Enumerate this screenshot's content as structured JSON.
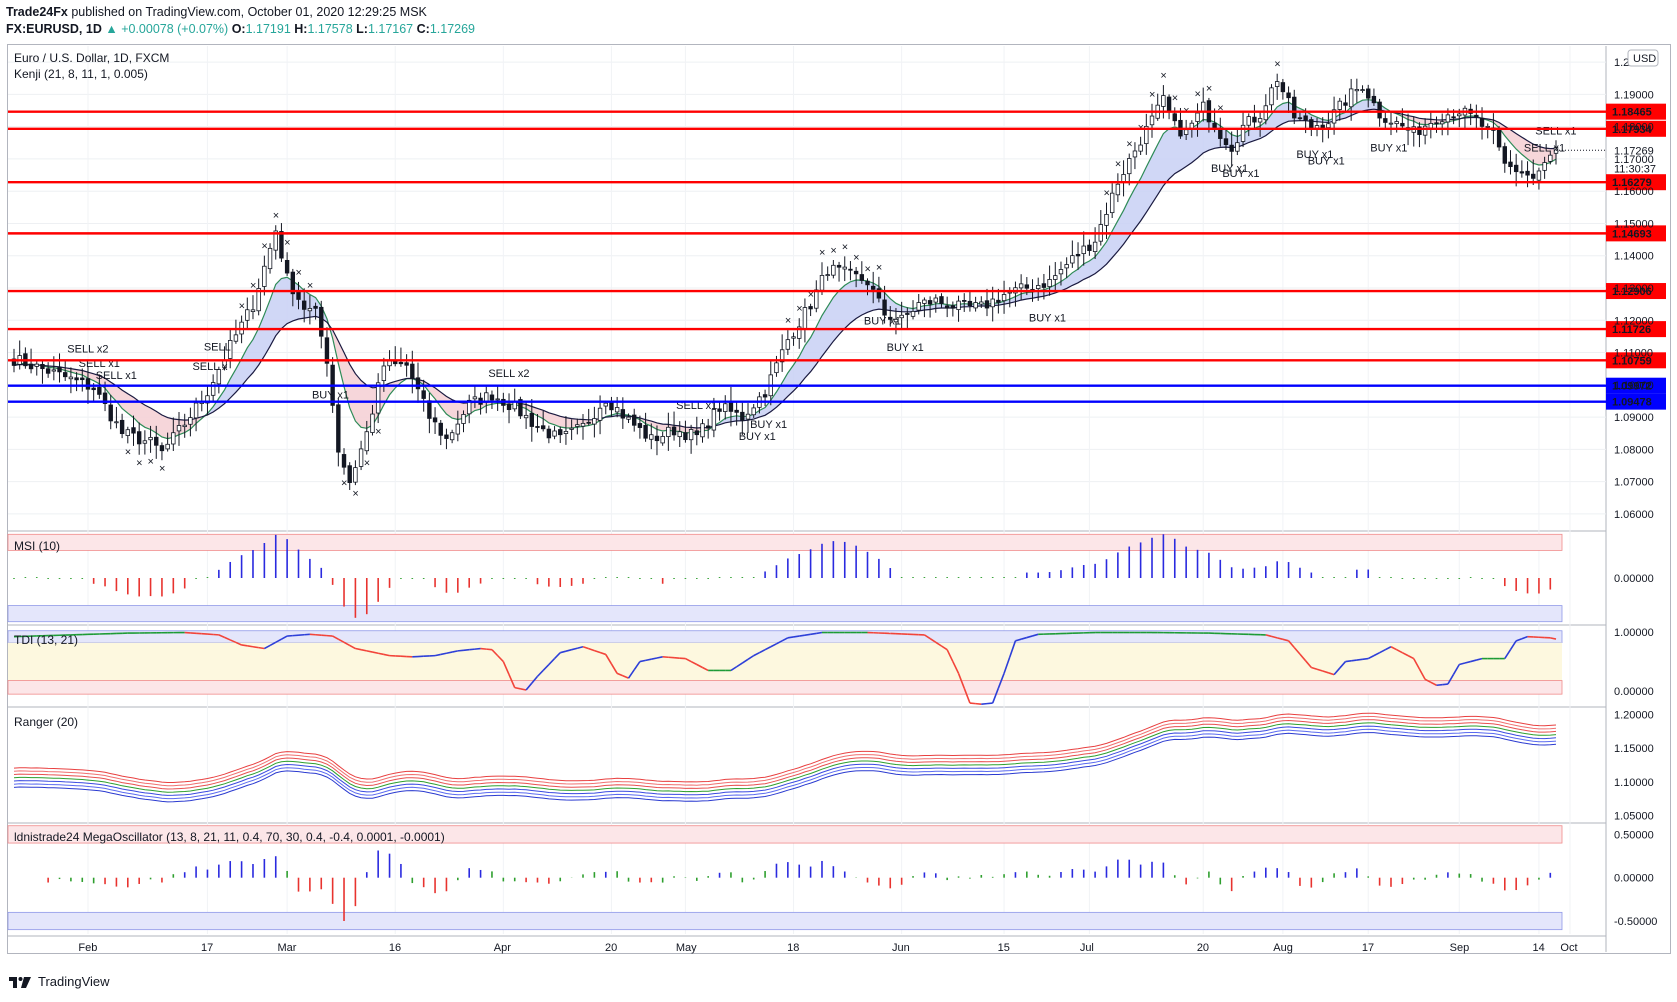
{
  "header": {
    "publisher": "Trade24Fx",
    "published_text": " published on TradingView.com, October 01, 2020 12:29:25 MSK",
    "symbol": "FX:EURUSD, 1D",
    "change_arrow": "▲",
    "change": "+0.00078 (+0.07%)",
    "o_label": "O:",
    "o": "1.17191",
    "h_label": "H:",
    "h": "1.17578",
    "l_label": "L:",
    "l": "1.17167",
    "c_label": "C:",
    "c": "1.17269"
  },
  "footer": {
    "brand": "TradingView",
    "logo": "tradingview-logo-icon"
  },
  "colors": {
    "up": "#26a69a",
    "bull_candle": "#ffffff",
    "bear_candle": "#131722",
    "level_red": "#ff0000",
    "level_blue": "#0000ff",
    "buy_mark": "#3b3bff",
    "sell_mark": "#ff4d4d",
    "cloud_up": "#c8d0f5",
    "cloud_down": "#f5cfd3",
    "osc_up": "#2a2adf",
    "osc_down": "#e8332f",
    "osc_flat": "#2e9f2e",
    "tdi_blue": "#2d3fd8",
    "tdi_red": "#f2443a",
    "tdi_green": "#1d9b36"
  },
  "chart_data": [
    {
      "pane": "price",
      "type": "candlestick",
      "title": "Euro / U.S. Dollar, 1D, FXCM",
      "indicator": "Kenji (21, 8, 11, 1, 0.005)",
      "currency_badge": "USD",
      "y_ticks": [
        "1.20000",
        "1.19000",
        "1.18000",
        "1.17000",
        "1.16000",
        "1.15000",
        "1.14000",
        "1.13000",
        "1.12000",
        "1.11000",
        "1.10000",
        "1.09000",
        "1.08000",
        "1.07000",
        "1.06000"
      ],
      "ylim": [
        1.055,
        1.205
      ],
      "x_ticks": [
        "Feb",
        "17",
        "Mar",
        "16",
        "Apr",
        "20",
        "May",
        "18",
        "Jun",
        "15",
        "Jul",
        "20",
        "Aug",
        "17",
        "Sep",
        "14",
        "Oct"
      ],
      "current_price": "1.17269",
      "countdown": "11:30:37",
      "levels": [
        {
          "value": 1.18465,
          "label": "1.18465",
          "color": "red"
        },
        {
          "value": 1.17934,
          "label": "1.17934",
          "color": "red"
        },
        {
          "value": 1.16279,
          "label": "1.16279",
          "color": "red"
        },
        {
          "value": 1.14693,
          "label": "1.14693",
          "color": "red"
        },
        {
          "value": 1.12906,
          "label": "1.12906",
          "color": "red"
        },
        {
          "value": 1.11726,
          "label": "1.11726",
          "color": "red"
        },
        {
          "value": 1.10759,
          "label": "1.10759",
          "color": "red"
        },
        {
          "value": 1.09972,
          "label": "1.09972",
          "color": "blue"
        },
        {
          "value": 1.09478,
          "label": "1.09478",
          "color": "blue"
        }
      ],
      "anchors": [
        [
          0,
          1.108
        ],
        [
          8,
          1.103
        ],
        [
          14,
          1.099
        ],
        [
          19,
          1.085
        ],
        [
          24,
          1.082
        ],
        [
          26,
          1.079
        ],
        [
          30,
          1.088
        ],
        [
          34,
          1.098
        ],
        [
          38,
          1.112
        ],
        [
          42,
          1.125
        ],
        [
          46,
          1.148
        ],
        [
          48,
          1.133
        ],
        [
          51,
          1.124
        ],
        [
          53,
          1.122
        ],
        [
          55,
          1.108
        ],
        [
          57,
          1.08
        ],
        [
          59,
          1.07
        ],
        [
          62,
          1.085
        ],
        [
          65,
          1.106
        ],
        [
          69,
          1.106
        ],
        [
          73,
          1.09
        ],
        [
          76,
          1.083
        ],
        [
          80,
          1.094
        ],
        [
          84,
          1.097
        ],
        [
          88,
          1.093
        ],
        [
          92,
          1.087
        ],
        [
          96,
          1.083
        ],
        [
          100,
          1.087
        ],
        [
          104,
          1.096
        ],
        [
          108,
          1.089
        ],
        [
          112,
          1.083
        ],
        [
          116,
          1.086
        ],
        [
          120,
          1.084
        ],
        [
          124,
          1.093
        ],
        [
          128,
          1.09
        ],
        [
          132,
          1.098
        ],
        [
          136,
          1.114
        ],
        [
          140,
          1.125
        ],
        [
          143,
          1.136
        ],
        [
          147,
          1.134
        ],
        [
          150,
          1.132
        ],
        [
          153,
          1.122
        ],
        [
          156,
          1.12
        ],
        [
          159,
          1.125
        ],
        [
          162,
          1.126
        ],
        [
          166,
          1.124
        ],
        [
          170,
          1.124
        ],
        [
          174,
          1.128
        ],
        [
          178,
          1.13
        ],
        [
          182,
          1.132
        ],
        [
          186,
          1.139
        ],
        [
          190,
          1.145
        ],
        [
          194,
          1.163
        ],
        [
          198,
          1.176
        ],
        [
          202,
          1.188
        ],
        [
          204,
          1.18
        ],
        [
          206,
          1.178
        ],
        [
          209,
          1.186
        ],
        [
          212,
          1.178
        ],
        [
          214,
          1.174
        ],
        [
          216,
          1.18
        ],
        [
          219,
          1.184
        ],
        [
          222,
          1.195
        ],
        [
          225,
          1.183
        ],
        [
          228,
          1.18
        ],
        [
          231,
          1.182
        ],
        [
          235,
          1.19
        ],
        [
          237,
          1.193
        ],
        [
          240,
          1.184
        ],
        [
          243,
          1.181
        ],
        [
          246,
          1.178
        ],
        [
          250,
          1.183
        ],
        [
          254,
          1.185
        ],
        [
          257,
          1.182
        ],
        [
          260,
          1.177
        ],
        [
          262,
          1.168
        ],
        [
          265,
          1.166
        ],
        [
          267,
          1.164
        ],
        [
          269,
          1.168
        ],
        [
          271,
          1.173
        ]
      ],
      "annotations": [
        {
          "text": "SELL x2",
          "i": 12,
          "type": "sell"
        },
        {
          "text": "SELL x1",
          "i": 14,
          "type": "sell"
        },
        {
          "text": "SELL x1",
          "i": 17,
          "type": "sell"
        },
        {
          "text": "SELL",
          "i": 36,
          "type": "sell"
        },
        {
          "text": "SELL x",
          "i": 34,
          "type": "sell"
        },
        {
          "text": "BUY x1",
          "i": 55,
          "type": "buy"
        },
        {
          "text": "SELL x2",
          "i": 86,
          "type": "sell"
        },
        {
          "text": "SELL x1",
          "i": 119,
          "type": "sell"
        },
        {
          "text": "BUY x1",
          "i": 132,
          "type": "buy"
        },
        {
          "text": "BUY x1",
          "i": 130,
          "type": "buy"
        },
        {
          "text": "BUY x1",
          "i": 152,
          "type": "buy"
        },
        {
          "text": "BUY x1",
          "i": 156,
          "type": "buy"
        },
        {
          "text": "BUY x1",
          "i": 181,
          "type": "buy"
        },
        {
          "text": "BUY x1",
          "i": 213,
          "type": "buy"
        },
        {
          "text": "BUY x1",
          "i": 215,
          "type": "buy"
        },
        {
          "text": "BUY x1",
          "i": 228,
          "type": "buy"
        },
        {
          "text": "BUY x1",
          "i": 230,
          "type": "buy"
        },
        {
          "text": "BUY x1",
          "i": 241,
          "type": "buy"
        },
        {
          "text": "SELL x1",
          "i": 268,
          "type": "sell"
        },
        {
          "text": "SELL x1",
          "i": 270,
          "type": "sell"
        }
      ]
    },
    {
      "pane": "msi",
      "type": "bar",
      "title": "MSI (10)",
      "y_ticks": [
        "0.00000"
      ],
      "ylim": [
        -1,
        1
      ]
    },
    {
      "pane": "tdi",
      "type": "line",
      "title": "TDI (13, 21)",
      "y_ticks": [
        "1.00000",
        "0.00000"
      ],
      "ylim": [
        -0.25,
        1.1
      ],
      "series": [
        {
          "values_anchor": [
            [
              0,
              0.92
            ],
            [
              10,
              0.95
            ],
            [
              20,
              0.98
            ],
            [
              30,
              0.99
            ],
            [
              36,
              0.95
            ],
            [
              40,
              0.78
            ],
            [
              44,
              0.72
            ],
            [
              48,
              0.93
            ],
            [
              52,
              0.96
            ],
            [
              56,
              0.93
            ],
            [
              60,
              0.72
            ],
            [
              66,
              0.6
            ],
            [
              70,
              0.58
            ],
            [
              74,
              0.6
            ],
            [
              78,
              0.68
            ],
            [
              82,
              0.72
            ],
            [
              84,
              0.7
            ],
            [
              86,
              0.5
            ],
            [
              88,
              0.06
            ],
            [
              90,
              0.02
            ],
            [
              92,
              0.25
            ],
            [
              96,
              0.65
            ],
            [
              100,
              0.75
            ],
            [
              104,
              0.62
            ],
            [
              106,
              0.3
            ],
            [
              108,
              0.22
            ],
            [
              110,
              0.5
            ],
            [
              114,
              0.58
            ],
            [
              118,
              0.55
            ],
            [
              122,
              0.35
            ],
            [
              126,
              0.35
            ],
            [
              130,
              0.6
            ],
            [
              136,
              0.9
            ],
            [
              142,
              0.99
            ],
            [
              150,
              0.99
            ],
            [
              160,
              0.95
            ],
            [
              164,
              0.7
            ],
            [
              166,
              0.3
            ],
            [
              168,
              -0.2
            ],
            [
              170,
              -0.22
            ],
            [
              172,
              -0.2
            ],
            [
              174,
              0.3
            ],
            [
              176,
              0.85
            ],
            [
              180,
              0.96
            ],
            [
              190,
              0.99
            ],
            [
              200,
              0.99
            ],
            [
              210,
              0.98
            ],
            [
              220,
              0.95
            ],
            [
              224,
              0.85
            ],
            [
              228,
              0.4
            ],
            [
              232,
              0.28
            ],
            [
              234,
              0.5
            ],
            [
              238,
              0.55
            ],
            [
              242,
              0.75
            ],
            [
              246,
              0.55
            ],
            [
              248,
              0.2
            ],
            [
              250,
              0.1
            ],
            [
              252,
              0.12
            ],
            [
              254,
              0.45
            ],
            [
              258,
              0.55
            ],
            [
              262,
              0.55
            ],
            [
              264,
              0.85
            ],
            [
              266,
              0.92
            ],
            [
              270,
              0.9
            ],
            [
              271,
              0.88
            ]
          ]
        }
      ]
    },
    {
      "pane": "ranger",
      "type": "line",
      "title": "Ranger (20)",
      "y_ticks": [
        "1.20000",
        "1.15000",
        "1.10000",
        "1.05000"
      ],
      "ylim": [
        1.04,
        1.21
      ]
    },
    {
      "pane": "mega",
      "type": "bar",
      "title": "ldnistrade24 MegaOscillator (13, 8, 21, 11, 0.4, 70, 30, 0.4, -0.4, 0.0001, -0.0001)",
      "y_ticks": [
        "0.50000",
        "0.00000",
        "-0.50000"
      ],
      "ylim": [
        -0.65,
        0.62
      ]
    }
  ]
}
